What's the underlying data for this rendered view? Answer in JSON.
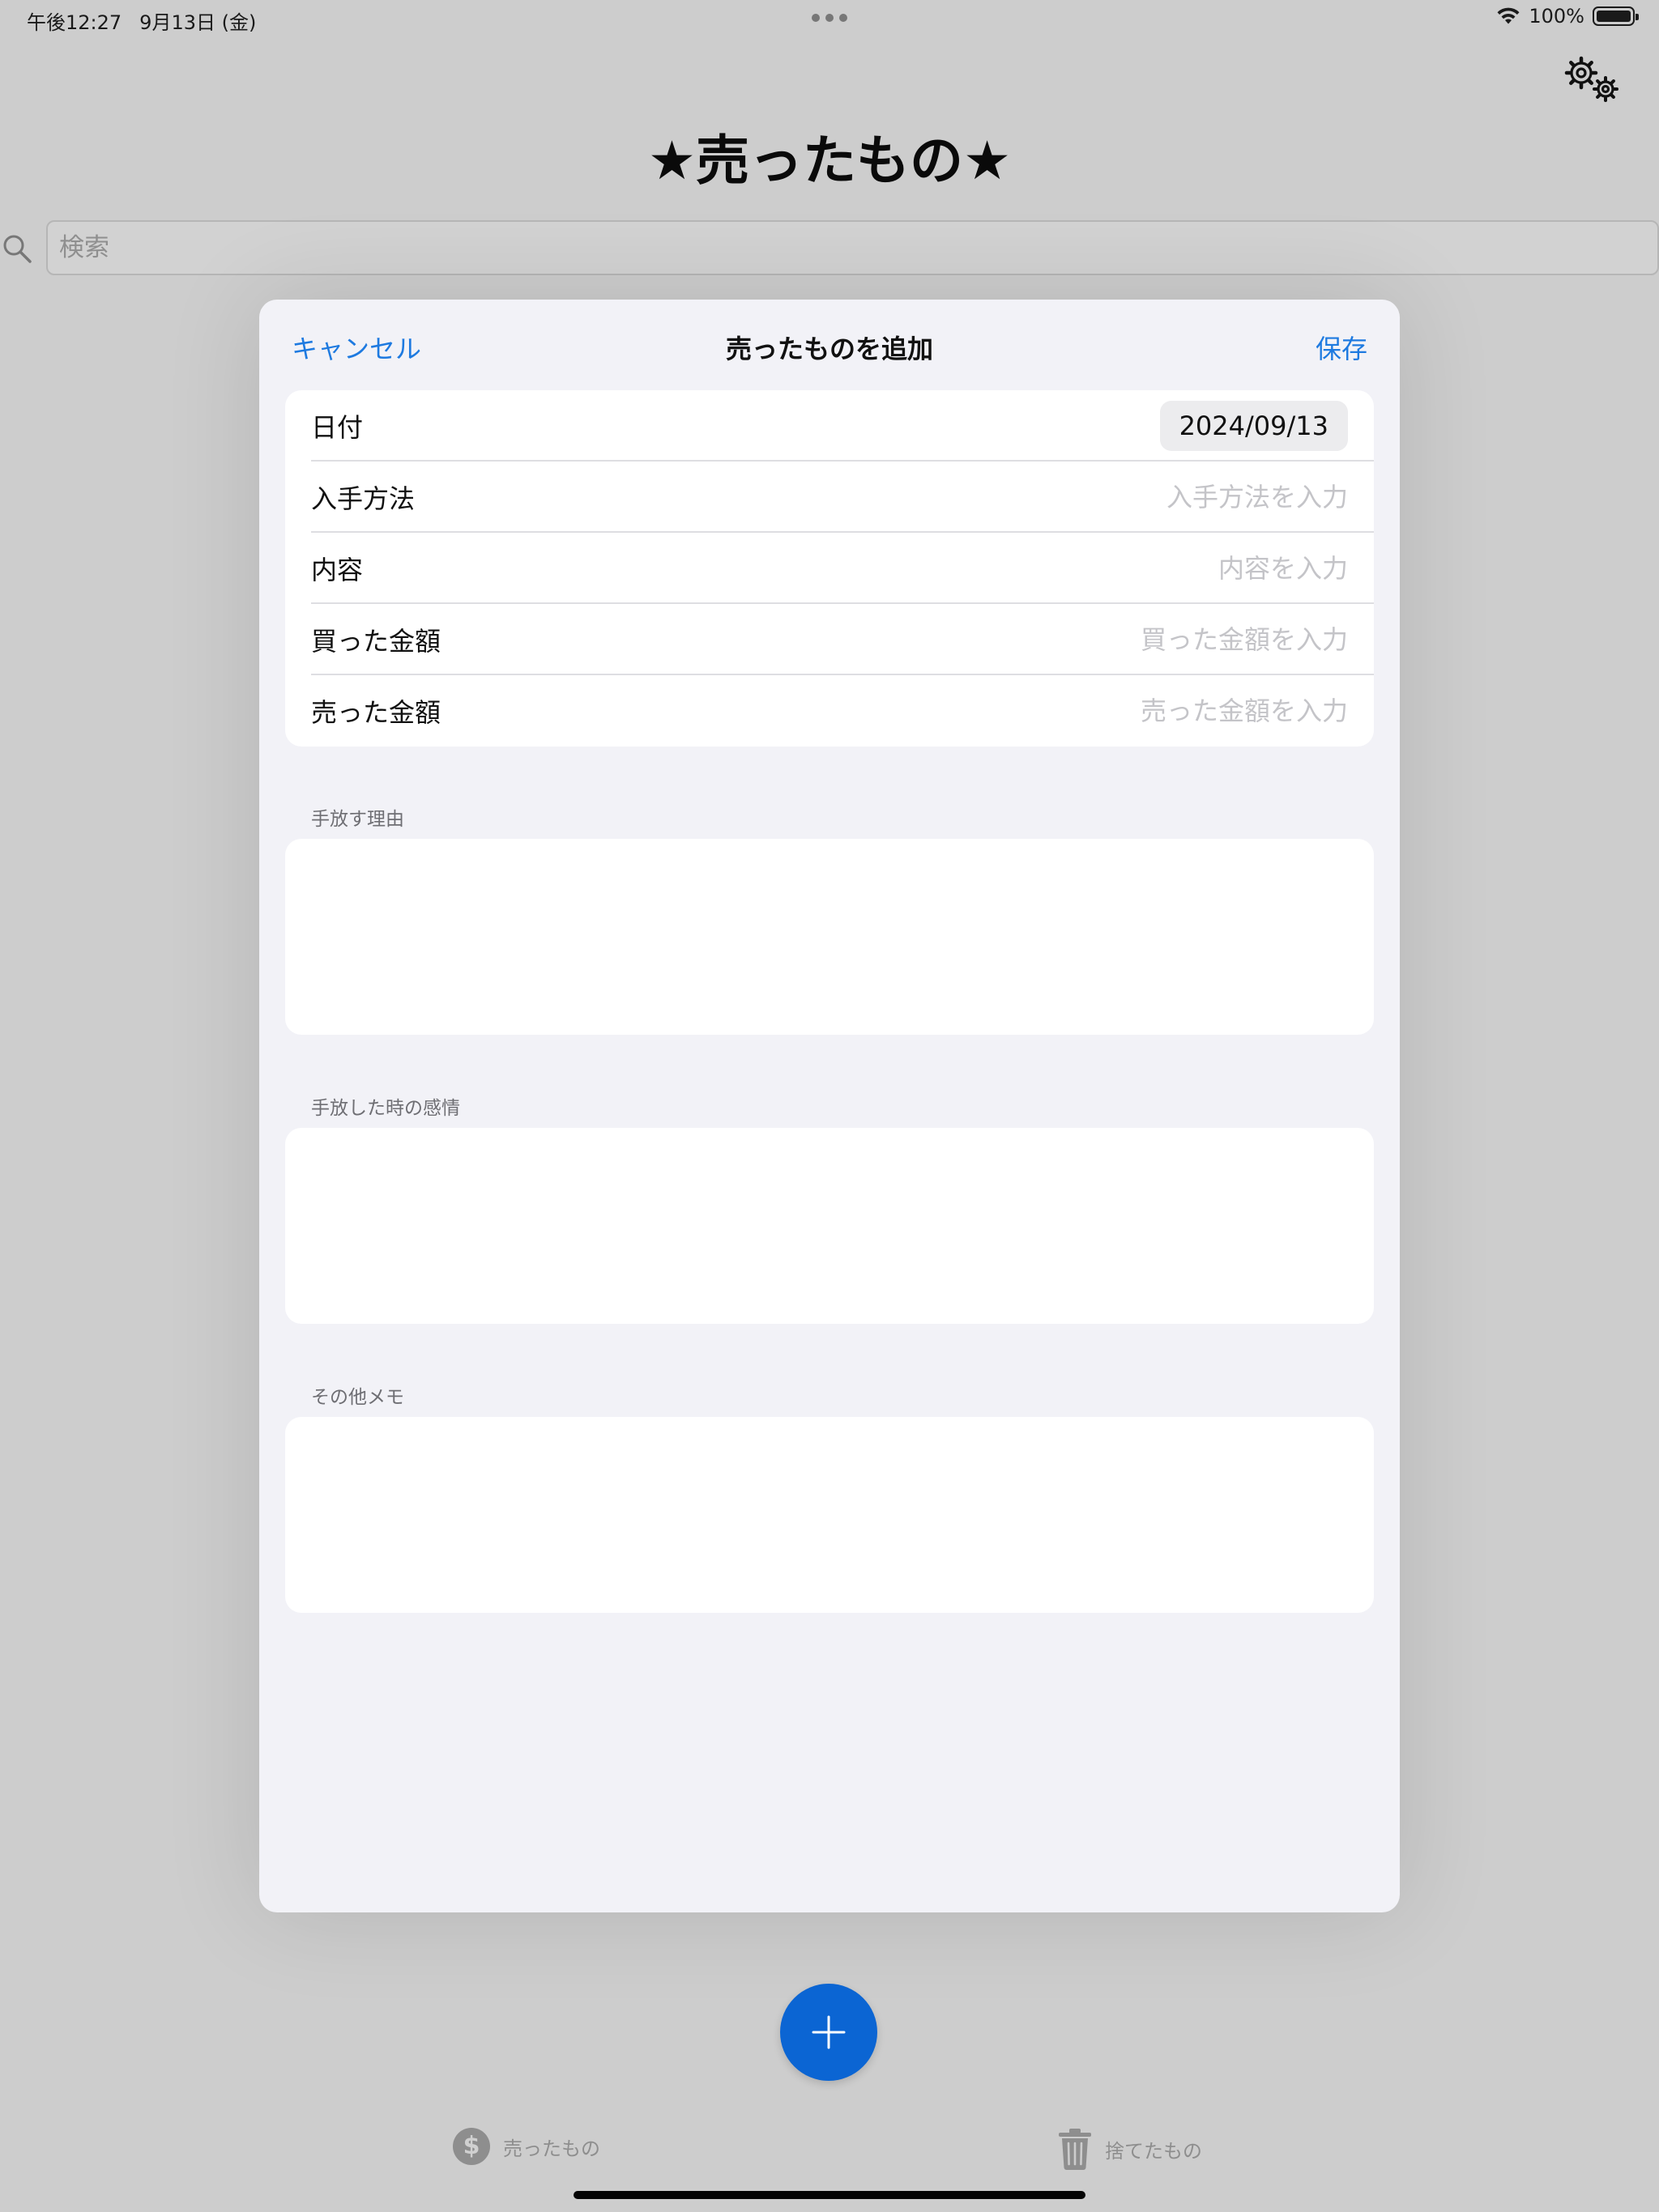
{
  "status_bar": {
    "time": "午後12:27",
    "date": "9月13日 (金)",
    "battery": "100%",
    "battery_level": 1.0
  },
  "header": {
    "title": "★売ったもの★",
    "settings_icon": "gears-icon"
  },
  "search": {
    "placeholder": "検索",
    "icon": "magnifying-glass-icon"
  },
  "modal": {
    "cancel_label": "キャンセル",
    "title": "売ったものを追加",
    "save_label": "保存",
    "fields": [
      {
        "label": "日付",
        "value": "2024/09/13"
      },
      {
        "label": "入手方法",
        "placeholder": "入手方法を入力"
      },
      {
        "label": "内容",
        "placeholder": "内容を入力"
      },
      {
        "label": "買った金額",
        "placeholder": "買った金額を入力"
      },
      {
        "label": "売った金額",
        "placeholder": "売った金額を入力"
      }
    ],
    "sections": [
      {
        "header": "手放す理由"
      },
      {
        "header": "手放した時の感情"
      },
      {
        "header": "その他メモ"
      }
    ]
  },
  "fab": {
    "icon": "plus-icon",
    "color": "#0b65d3"
  },
  "tabs": [
    {
      "label": "売ったもの",
      "icon": "dollar-icon",
      "icon_glyph": "$"
    },
    {
      "label": "捨てたもの",
      "icon": "trash-icon"
    }
  ],
  "colors": {
    "accent": "#1e7ae0",
    "background_dim": "#cdcdcd",
    "sheet": "#f2f2f7"
  }
}
